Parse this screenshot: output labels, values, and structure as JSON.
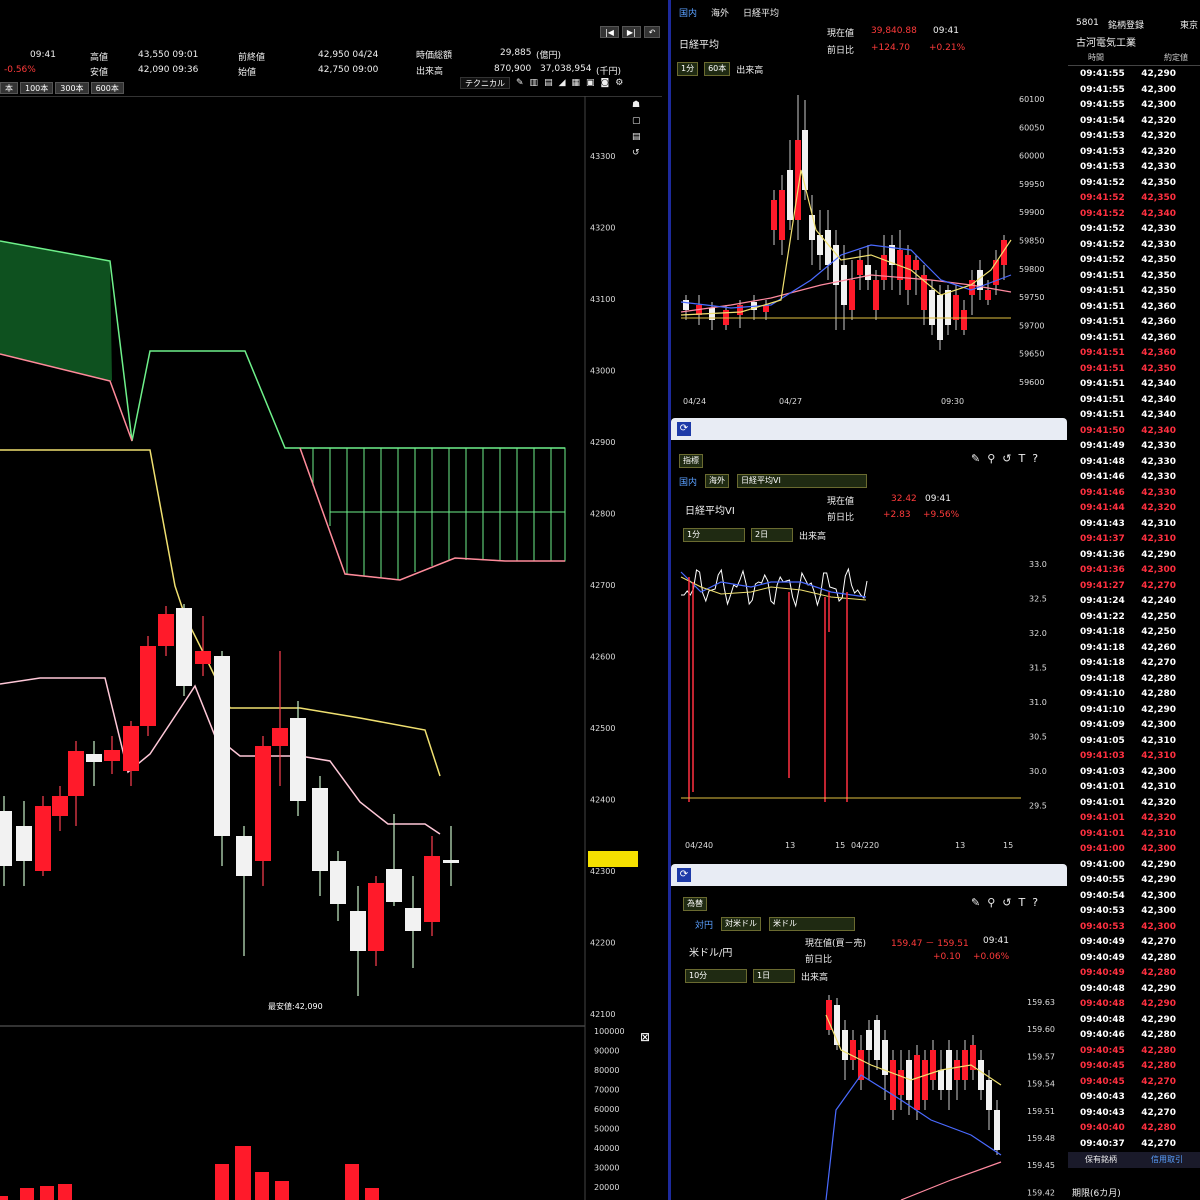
{
  "main": {
    "time": "09:41",
    "change_pct": "-0.56%",
    "high_label": "高値",
    "high_value": "43,550 09:01",
    "low_label": "安値",
    "low_value": "42,090 09:36",
    "prev_close_label": "前終値",
    "prev_close_value": "42,950 04/24",
    "open_label": "始値",
    "open_value": "42,750 09:00",
    "mktcap_label": "時価総額",
    "mktcap_value": "29,885",
    "mktcap_unit": "(億円)",
    "volume_label": "出来高",
    "volume_value": "870,900",
    "turnover_value": "37,038,954",
    "turnover_unit": "(千円)",
    "bar_buttons": [
      "本",
      "100本",
      "300本",
      "600本"
    ],
    "tech_label": "テクニカル",
    "price_axis": [
      "43300",
      "43200",
      "43100",
      "43000",
      "42900",
      "42800",
      "42700",
      "42600",
      "42500",
      "42400",
      "42300",
      "42200",
      "42100"
    ],
    "current_price_marker": "42300",
    "low_annotation": "最安値:42,090",
    "volume_axis": [
      "100000",
      "90000",
      "80000",
      "70000",
      "60000",
      "50000",
      "40000",
      "30000",
      "20000"
    ]
  },
  "nikkei": {
    "tabs": [
      "国内",
      "海外",
      "日経平均"
    ],
    "name": "日経平均",
    "price_label": "現在値",
    "price_value": "39,840.88",
    "price_time": "09:41",
    "change_label": "前日比",
    "change_value": "+124.70",
    "change_pct": "+0.21%",
    "interval": "1分",
    "bars": "60本",
    "checkbox_label": "出来高",
    "y_axis": [
      "60100",
      "60050",
      "60000",
      "59950",
      "59900",
      "59850",
      "59800",
      "59750",
      "59700",
      "59650",
      "59600"
    ],
    "x_axis": [
      "04/24",
      "04/27",
      "09:30"
    ]
  },
  "vi": {
    "category": "指標",
    "tabs": [
      "国内",
      "海外",
      "日経平均VI"
    ],
    "name": "日経平均VI",
    "price_label": "現在値",
    "price_value": "32.42",
    "price_time": "09:41",
    "change_label": "前日比",
    "change_value": "+2.83",
    "change_pct": "+9.56%",
    "interval": "1分",
    "days": "2日",
    "checkbox_label": "出来高",
    "y_axis": [
      "33.0",
      "32.5",
      "32.0",
      "31.5",
      "31.0",
      "30.5",
      "30.0",
      "29.5"
    ],
    "x_axis": [
      "04/240",
      "13",
      "15",
      "04/220",
      "13",
      "15"
    ]
  },
  "fx": {
    "category": "為替",
    "tabs": [
      "対円",
      "対米ドル",
      "米ドル"
    ],
    "name": "米ドル/円",
    "price_label": "現在値(買－売)",
    "price_value": "159.47 － 159.51",
    "price_time": "09:41",
    "change_label": "前日比",
    "change_value": "+0.10",
    "change_pct": "+0.06%",
    "interval": "10分",
    "days": "1日",
    "checkbox_label": "出来高",
    "y_axis": [
      "159.63",
      "159.60",
      "159.57",
      "159.54",
      "159.51",
      "159.48",
      "159.45",
      "159.42"
    ]
  },
  "tape": {
    "code": "5801",
    "market": "東京",
    "name_label": "銘柄登録",
    "name": "古河電気工業",
    "col_time": "時間",
    "col_price": "約定値",
    "rows": [
      [
        "09:41:55",
        "42,290",
        "w"
      ],
      [
        "09:41:55",
        "42,300",
        "w"
      ],
      [
        "09:41:55",
        "42,300",
        "w"
      ],
      [
        "09:41:54",
        "42,320",
        "w"
      ],
      [
        "09:41:53",
        "42,320",
        "w"
      ],
      [
        "09:41:53",
        "42,320",
        "w"
      ],
      [
        "09:41:53",
        "42,330",
        "w"
      ],
      [
        "09:41:52",
        "42,350",
        "w"
      ],
      [
        "09:41:52",
        "42,350",
        "r"
      ],
      [
        "09:41:52",
        "42,340",
        "r"
      ],
      [
        "09:41:52",
        "42,330",
        "w"
      ],
      [
        "09:41:52",
        "42,330",
        "w"
      ],
      [
        "09:41:52",
        "42,350",
        "w"
      ],
      [
        "09:41:51",
        "42,350",
        "w"
      ],
      [
        "09:41:51",
        "42,350",
        "w"
      ],
      [
        "09:41:51",
        "42,360",
        "w"
      ],
      [
        "09:41:51",
        "42,360",
        "w"
      ],
      [
        "09:41:51",
        "42,360",
        "w"
      ],
      [
        "09:41:51",
        "42,360",
        "r"
      ],
      [
        "09:41:51",
        "42,350",
        "r"
      ],
      [
        "09:41:51",
        "42,340",
        "w"
      ],
      [
        "09:41:51",
        "42,340",
        "w"
      ],
      [
        "09:41:51",
        "42,340",
        "w"
      ],
      [
        "09:41:50",
        "42,340",
        "r"
      ],
      [
        "09:41:49",
        "42,330",
        "w"
      ],
      [
        "09:41:48",
        "42,330",
        "w"
      ],
      [
        "09:41:46",
        "42,330",
        "w"
      ],
      [
        "09:41:46",
        "42,330",
        "r"
      ],
      [
        "09:41:44",
        "42,320",
        "r"
      ],
      [
        "09:41:43",
        "42,310",
        "w"
      ],
      [
        "09:41:37",
        "42,310",
        "r"
      ],
      [
        "09:41:36",
        "42,290",
        "w"
      ],
      [
        "09:41:36",
        "42,300",
        "r"
      ],
      [
        "09:41:27",
        "42,270",
        "r"
      ],
      [
        "09:41:24",
        "42,240",
        "w"
      ],
      [
        "09:41:22",
        "42,250",
        "w"
      ],
      [
        "09:41:18",
        "42,250",
        "w"
      ],
      [
        "09:41:18",
        "42,260",
        "w"
      ],
      [
        "09:41:18",
        "42,270",
        "w"
      ],
      [
        "09:41:18",
        "42,280",
        "w"
      ],
      [
        "09:41:10",
        "42,280",
        "w"
      ],
      [
        "09:41:10",
        "42,290",
        "w"
      ],
      [
        "09:41:09",
        "42,300",
        "w"
      ],
      [
        "09:41:05",
        "42,310",
        "w"
      ],
      [
        "09:41:03",
        "42,310",
        "r"
      ],
      [
        "09:41:03",
        "42,300",
        "w"
      ],
      [
        "09:41:01",
        "42,310",
        "w"
      ],
      [
        "09:41:01",
        "42,320",
        "w"
      ],
      [
        "09:41:01",
        "42,320",
        "r"
      ],
      [
        "09:41:01",
        "42,310",
        "r"
      ],
      [
        "09:41:00",
        "42,300",
        "r"
      ],
      [
        "09:41:00",
        "42,290",
        "w"
      ],
      [
        "09:40:55",
        "42,290",
        "w"
      ],
      [
        "09:40:54",
        "42,300",
        "w"
      ],
      [
        "09:40:53",
        "42,300",
        "w"
      ],
      [
        "09:40:53",
        "42,300",
        "r"
      ],
      [
        "09:40:49",
        "42,270",
        "w"
      ],
      [
        "09:40:49",
        "42,280",
        "w"
      ],
      [
        "09:40:49",
        "42,280",
        "r"
      ],
      [
        "09:40:48",
        "42,290",
        "w"
      ],
      [
        "09:40:48",
        "42,290",
        "r"
      ],
      [
        "09:40:48",
        "42,290",
        "w"
      ],
      [
        "09:40:46",
        "42,280",
        "w"
      ],
      [
        "09:40:45",
        "42,280",
        "r"
      ],
      [
        "09:40:45",
        "42,280",
        "r"
      ],
      [
        "09:40:45",
        "42,270",
        "r"
      ],
      [
        "09:40:43",
        "42,260",
        "w"
      ],
      [
        "09:40:43",
        "42,270",
        "w"
      ],
      [
        "09:40:40",
        "42,280",
        "r"
      ],
      [
        "09:40:37",
        "42,270",
        "w"
      ]
    ],
    "footer_left": "保有銘柄",
    "footer_right": "信用取引",
    "footer_bottom": "期限(6カ月)"
  }
}
